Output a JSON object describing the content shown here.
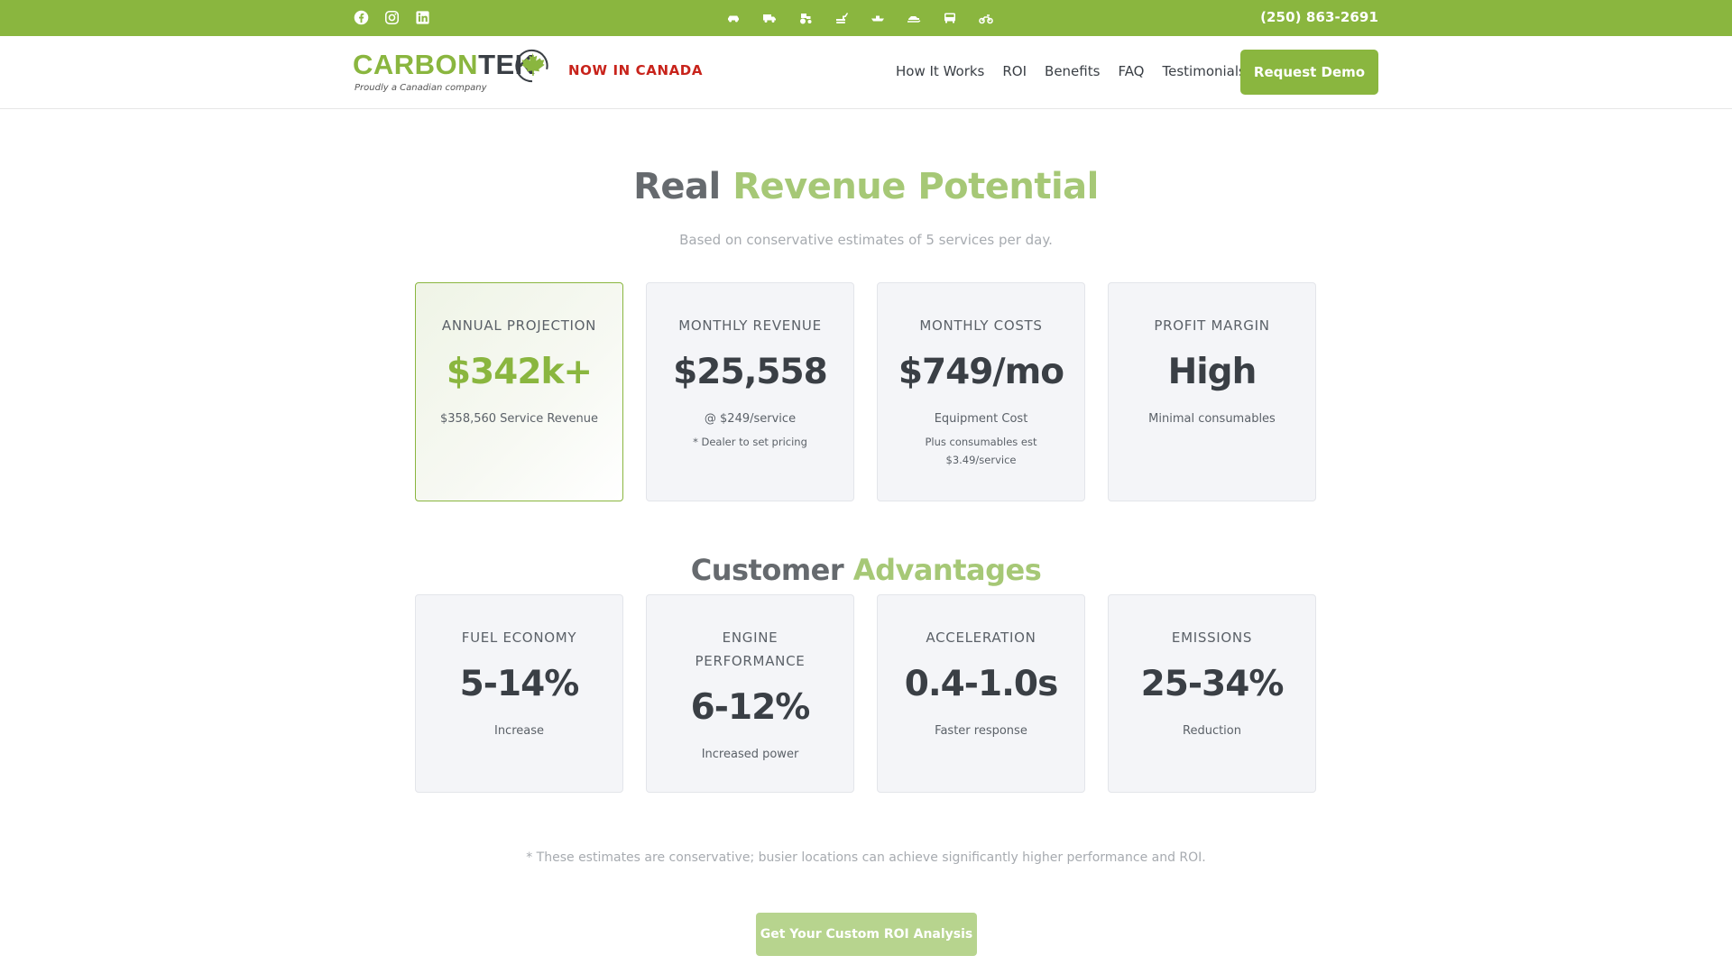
{
  "topbar": {
    "social_icons": [
      "facebook-icon",
      "instagram-icon",
      "linkedin-icon"
    ],
    "vehicle_icons": [
      "car-icon",
      "truck-icon",
      "tractor-icon",
      "excavator-icon",
      "boat-icon",
      "snowmobile-icon",
      "bus-icon",
      "motorcycle-icon"
    ],
    "phone": "(250) 863-2691"
  },
  "header": {
    "logo_part1": "CARBON",
    "logo_part2": "TEK",
    "logo_tagline": "Proudly a Canadian company",
    "announcement": "NOW IN CANADA",
    "nav": [
      "How It Works",
      "ROI",
      "Benefits",
      "FAQ",
      "Testimonials"
    ],
    "cta": "Request Demo"
  },
  "revenue": {
    "title_plain": "Real",
    "title_accent": "Revenue Potential",
    "subtitle": "Based on conservative estimates of 5 services per day.",
    "cards": [
      {
        "label": "ANNUAL PROJECTION",
        "value": "$342k+",
        "desc": "$358,560 Service Revenue",
        "note": ""
      },
      {
        "label": "MONTHLY REVENUE",
        "value": "$25,558",
        "desc": "@ $249/service",
        "note": "* Dealer to set pricing"
      },
      {
        "label": "MONTHLY COSTS",
        "value": "$749/mo",
        "desc": "Equipment Cost",
        "note": "Plus consumables est $3.49/service"
      },
      {
        "label": "PROFIT MARGIN",
        "value": "High",
        "desc": "Minimal consumables",
        "note": ""
      }
    ]
  },
  "advantages": {
    "title_plain": "Customer",
    "title_accent": "Advantages",
    "cards": [
      {
        "label": "FUEL ECONOMY",
        "value": "5-14%",
        "desc": "Increase"
      },
      {
        "label": "ENGINE PERFORMANCE",
        "value": "6-12%",
        "desc": "Increased power"
      },
      {
        "label": "ACCELERATION",
        "value": "0.4-1.0s",
        "desc": "Faster response"
      },
      {
        "label": "EMISSIONS",
        "value": "25-34%",
        "desc": "Reduction"
      }
    ]
  },
  "footnote": "* These estimates are conservative; busier locations can achieve significantly higher performance and ROI.",
  "roi_cta": "Get Your Custom ROI Analysis",
  "colors": {
    "brand_green": "#8ab63f",
    "accent_light_green": "#a6c876",
    "announcement_red": "#c8231b",
    "dark_text": "#3a3f45"
  }
}
